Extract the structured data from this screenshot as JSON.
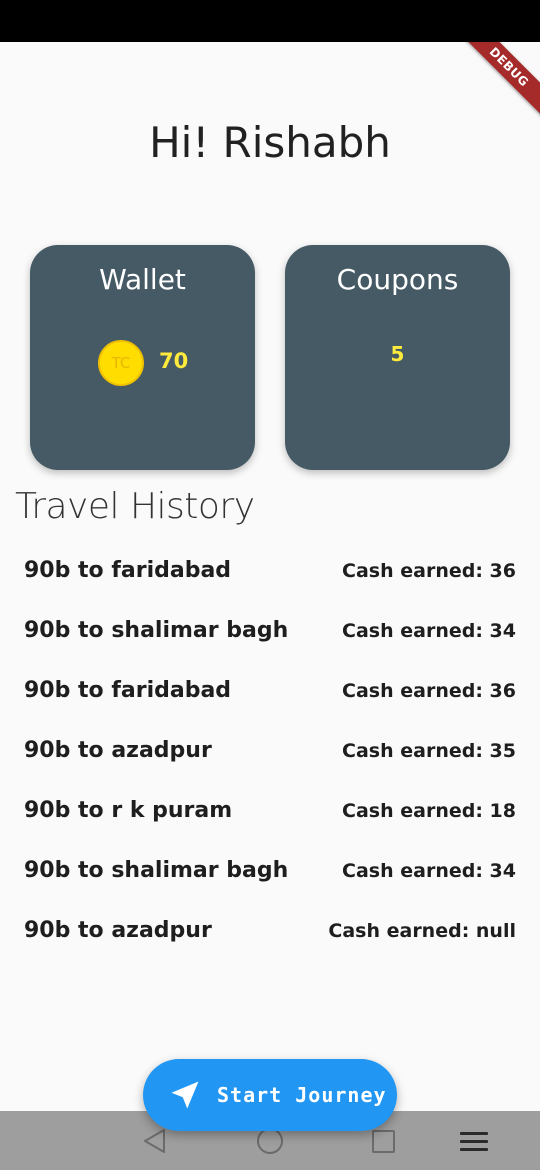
{
  "greeting": "Hi! Rishabh",
  "debug_label": "DEBUG",
  "wallet": {
    "title": "Wallet",
    "coin_label": "TC",
    "value": "70"
  },
  "coupons": {
    "title": "Coupons",
    "value": "5"
  },
  "history": {
    "title": "Travel History",
    "items": [
      {
        "route": "90b to faridabad",
        "cash": "Cash earned: 36"
      },
      {
        "route": "90b to shalimar bagh",
        "cash": "Cash earned: 34"
      },
      {
        "route": "90b to faridabad",
        "cash": "Cash earned: 36"
      },
      {
        "route": "90b to azadpur",
        "cash": "Cash earned: 35"
      },
      {
        "route": "90b to r k puram",
        "cash": "Cash earned: 18"
      },
      {
        "route": "90b to shalimar bagh",
        "cash": "Cash earned: 34"
      },
      {
        "route": "90b to azadpur",
        "cash": "Cash earned: null"
      }
    ]
  },
  "fab": {
    "label": "Start Journey",
    "icon": "navigation-arrow-icon"
  },
  "colors": {
    "card_bg": "#455a64",
    "accent_yellow": "#ffeb3b",
    "fab_blue": "#2196f3",
    "debug_red": "#a52a2a"
  },
  "nav_icons": [
    "back-icon",
    "home-icon",
    "recents-icon",
    "menu-icon"
  ]
}
